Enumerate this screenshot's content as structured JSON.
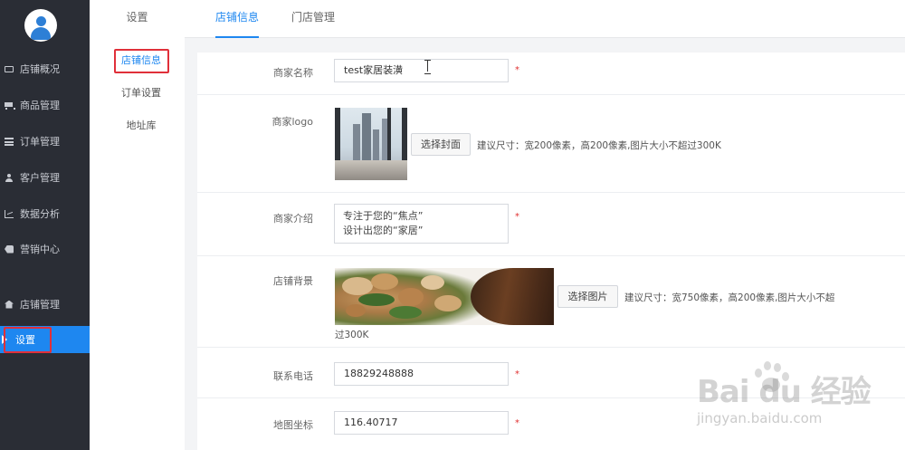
{
  "sidebar": {
    "items": [
      {
        "label": "店铺概况",
        "icon": "monitor-icon"
      },
      {
        "label": "商品管理",
        "icon": "cart-icon"
      },
      {
        "label": "订单管理",
        "icon": "list-icon"
      },
      {
        "label": "客户管理",
        "icon": "user-icon"
      },
      {
        "label": "数据分析",
        "icon": "chart-icon"
      },
      {
        "label": "营销中心",
        "icon": "tag-icon"
      },
      {
        "label": "店铺管理",
        "icon": "home-icon"
      },
      {
        "label": "设置",
        "icon": "play-icon",
        "active": true
      }
    ],
    "active_color": "#1e87f0"
  },
  "submenu": {
    "title": "设置",
    "items": [
      {
        "label": "店铺信息",
        "active": true
      },
      {
        "label": "订单设置"
      },
      {
        "label": "地址库"
      }
    ]
  },
  "tabs": [
    {
      "label": "店铺信息",
      "active": true
    },
    {
      "label": "门店管理"
    }
  ],
  "form": {
    "shop_name": {
      "label": "商家名称",
      "value": "test家居装潢"
    },
    "logo": {
      "label": "商家logo",
      "button": "选择封面",
      "hint": "建议尺寸：宽200像素，高200像素,图片大小不超过300K"
    },
    "intro": {
      "label": "商家介绍",
      "line1": "专注于您的“焦点”",
      "line2": "设计出您的“家居”"
    },
    "background": {
      "label": "店铺背景",
      "button": "选择图片",
      "hint_line1": "建议尺寸：宽750像素，高200像素,图片大小不超",
      "hint_line2": "过300K"
    },
    "phone": {
      "label": "联系电话",
      "value": "18829248888"
    },
    "coords": {
      "label": "地图坐标",
      "value": "116.40717"
    },
    "required_mark": "*"
  },
  "highlight_color": "#e0303a",
  "watermark": {
    "brand": "Bai du 经验",
    "url": "jingyan.baidu.com"
  }
}
